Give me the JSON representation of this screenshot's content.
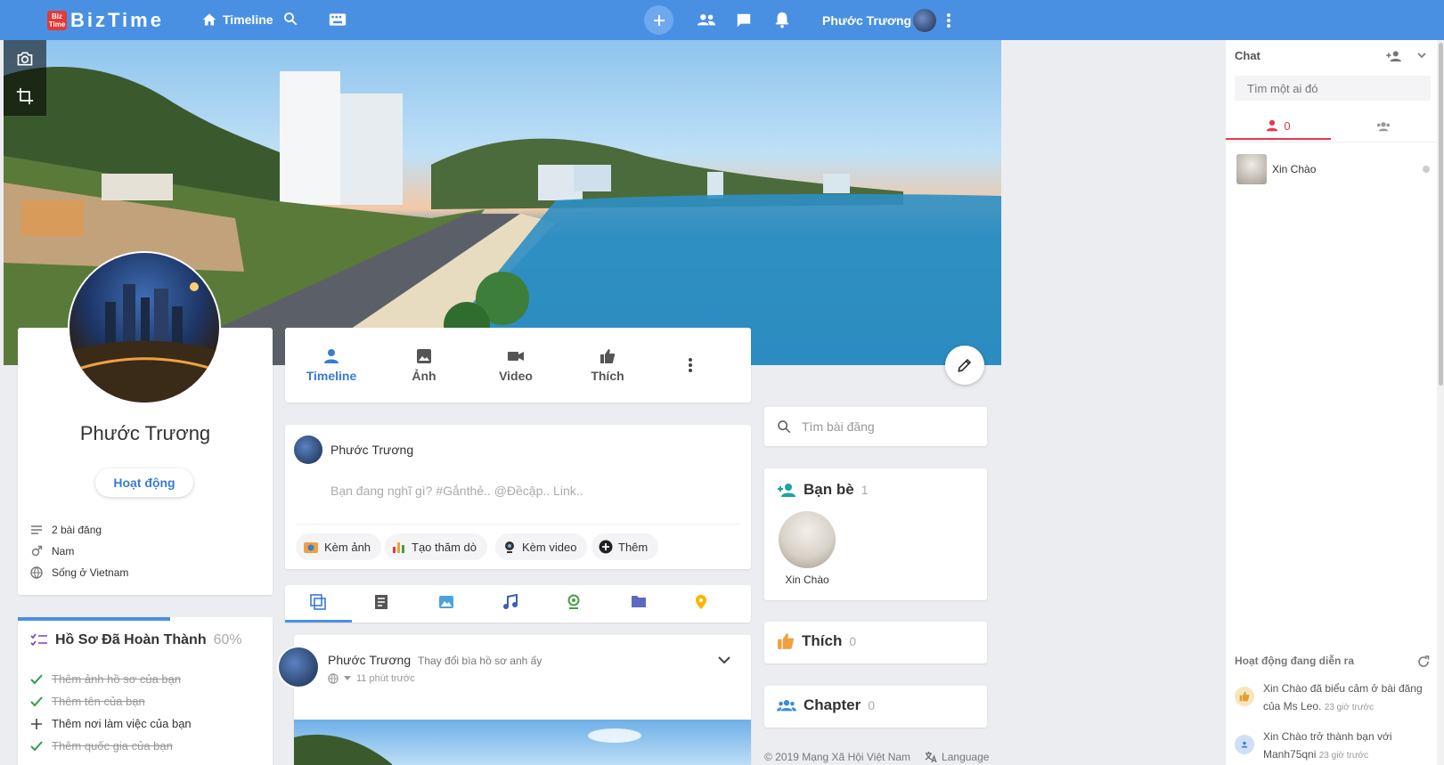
{
  "topbar": {
    "logo_box": "Biz Time",
    "logo_text": "BizTime",
    "nav_timeline": "Timeline",
    "user_name": "Phước Trương"
  },
  "profile": {
    "name": "Phước Trương",
    "activity_button": "Hoạt động",
    "info": [
      {
        "icon": "posts-icon",
        "text": "2 bài đăng"
      },
      {
        "icon": "gender-icon",
        "text": "Nam"
      },
      {
        "icon": "globe-icon",
        "text": "Sống ở Vietnam"
      }
    ]
  },
  "completion": {
    "title": "Hồ Sơ Đã Hoàn Thành",
    "percent_label": "60%",
    "progress": 0.6,
    "items": [
      {
        "text": "Thêm ảnh hồ sơ của bạn",
        "done": true
      },
      {
        "text": "Thêm tên của bạn",
        "done": true
      },
      {
        "text": "Thêm nơi làm việc của bạn",
        "done": false
      },
      {
        "text": "Thêm quốc gia của bạn",
        "done": true
      }
    ]
  },
  "tabs": [
    {
      "label": "Timeline",
      "icon": "person-icon",
      "active": true
    },
    {
      "label": "Ảnh",
      "icon": "image-icon",
      "active": false
    },
    {
      "label": "Video",
      "icon": "videocam-icon",
      "active": false
    },
    {
      "label": "Thích",
      "icon": "thumb-up-icon",
      "active": false
    }
  ],
  "composer": {
    "user_name": "Phước Trương",
    "placeholder": "Bạn đang nghĩ gì? #Gắnthẻ.. @Đềcập.. Link..",
    "chips": [
      "Kèm ảnh",
      "Tạo thăm dò",
      "Kèm video",
      "Thêm"
    ]
  },
  "post": {
    "author": "Phước Trương",
    "action": "Thay đổi bìa hồ sơ anh ấy",
    "time": "11 phút trước"
  },
  "widgets": {
    "search_placeholder": "Tìm bài đăng",
    "friends_title": "Bạn bè",
    "friends_count": "1",
    "friend_name": "Xin Chào",
    "like_title": "Thích",
    "like_count": "0",
    "chapter_title": "Chapter",
    "chapter_count": "0",
    "footer_copy": "© 2019 Mạng Xã Hội Việt Nam",
    "footer_language": "Language"
  },
  "chat": {
    "title": "Chat",
    "search_placeholder": "Tìm một ai đó",
    "online_count": "0",
    "contact_name": "Xin Chào",
    "activity_title": "Hoạt động đang diễn ra",
    "activities": [
      {
        "text": "Xin Chào đã biểu cảm ở bài đăng của Ms Leo.",
        "time": "23 giờ trước"
      },
      {
        "text": "Xin Chào trở thành bạn với Manh75qni",
        "time": "23 giờ trước"
      }
    ]
  },
  "colors": {
    "topbar": "#4a90e2",
    "accent": "#3a7bd5",
    "chat_accent": "#e53950"
  }
}
